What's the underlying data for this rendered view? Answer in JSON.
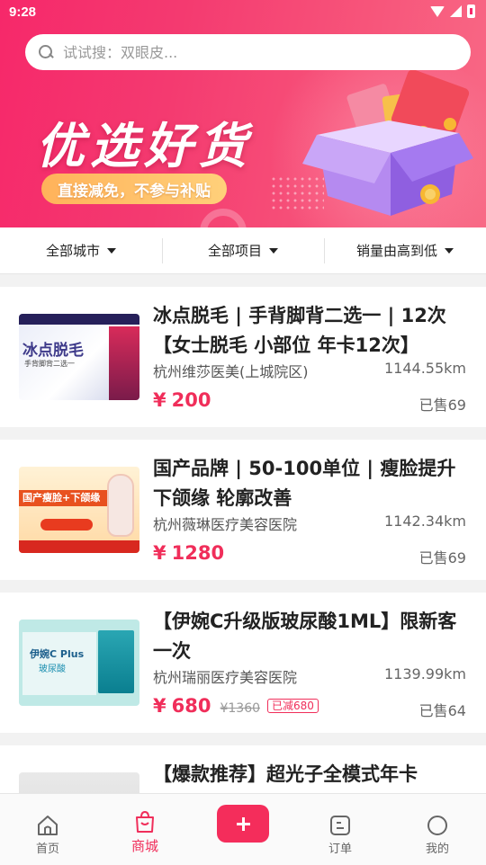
{
  "status": {
    "time": "9:28"
  },
  "search": {
    "placeholder": "试试搜：双眼皮..."
  },
  "banner": {
    "title": "优选好货",
    "subtitle": "直接减免，不参与补贴"
  },
  "filters": [
    {
      "label": "全部城市"
    },
    {
      "label": "全部项目"
    },
    {
      "label": "销量由高到低"
    }
  ],
  "products": [
    {
      "title": "冰点脱毛 | 手背脚背二选一 | 12次【女士脱毛 小部位 年卡12次】",
      "shop": "杭州维莎医美(上城院区)",
      "distance": "1144.55km",
      "currency": "¥",
      "price": "200",
      "sold": "已售69",
      "thumb": {
        "headline": "冰点脱毛",
        "caption": "手背脚背二选一"
      }
    },
    {
      "title": "国产品牌 | 50-100单位 | 瘦脸提升 下颌缘 轮廓改善",
      "shop": "杭州薇琳医疗美容医院",
      "distance": "1142.34km",
      "currency": "¥",
      "price": "1280",
      "sold": "已售69",
      "thumb": {
        "headline": "国产瘦脸+下颌缘"
      }
    },
    {
      "title": "【伊婉C升级版玻尿酸1ML】限新客一次",
      "shop": "杭州瑞丽医疗美容医院",
      "distance": "1139.99km",
      "currency": "¥",
      "price": "680",
      "original_price": "¥1360",
      "discount_tag": "已减680",
      "sold": "已售64",
      "thumb": {
        "headline": "伊婉C Plus",
        "caption": "玻尿酸"
      }
    },
    {
      "title": "【爆款推荐】超光子全模式年卡"
    }
  ],
  "nav": {
    "home": "首页",
    "mall": "商城",
    "orders": "订单",
    "mine": "我的"
  },
  "colors": {
    "accent": "#f02e5a",
    "banner": "#f6286a"
  }
}
